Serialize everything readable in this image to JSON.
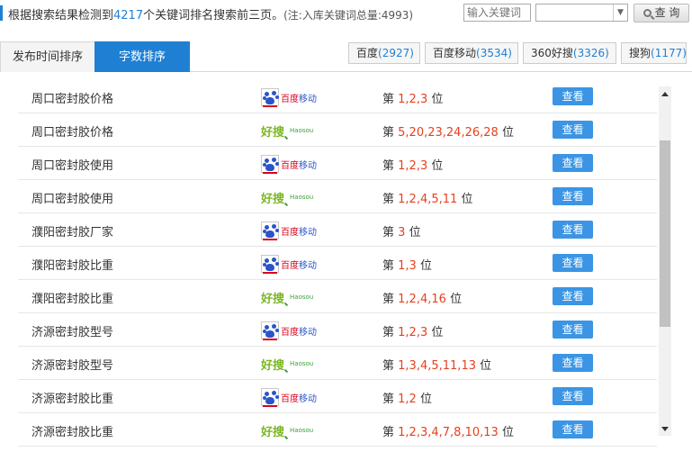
{
  "summary": {
    "prefix": "根据搜索结果检测到",
    "count": "4217",
    "suffix": "个关键词排名搜索前三页。",
    "note": "(注:入库关键词总量:4993)"
  },
  "search": {
    "placeholder": "输入关键词",
    "select_value": "",
    "query_label": "查 询"
  },
  "tabs": [
    {
      "label": "发布时间排序",
      "active": false
    },
    {
      "label": "字数排序",
      "active": true
    }
  ],
  "engines": [
    {
      "name": "百度",
      "count": "(2927)"
    },
    {
      "name": "百度移动",
      "count": "(3534)"
    },
    {
      "name": "360好搜",
      "count": "(3326)"
    },
    {
      "name": "搜狗",
      "count": "(1177)"
    }
  ],
  "logos": {
    "baidu_text_red": "百度",
    "baidu_text_blue": "移动",
    "hao_text_1": "好",
    "hao_text_2": "搜",
    "hao_text_en": "Haosou"
  },
  "rank_prefix": "第",
  "rank_suffix": "位",
  "view_label": "查看",
  "rows": [
    {
      "keyword": "周口密封胶价格",
      "engine": "baidu-mobile",
      "positions": "1,2,3"
    },
    {
      "keyword": "周口密封胶价格",
      "engine": "haosou",
      "positions": "5,20,23,24,26,28"
    },
    {
      "keyword": "周口密封胶使用",
      "engine": "baidu-mobile",
      "positions": "1,2,3"
    },
    {
      "keyword": "周口密封胶使用",
      "engine": "haosou",
      "positions": "1,2,4,5,11"
    },
    {
      "keyword": "濮阳密封胶厂家",
      "engine": "baidu-mobile",
      "positions": "3"
    },
    {
      "keyword": "濮阳密封胶比重",
      "engine": "baidu-mobile",
      "positions": "1,3"
    },
    {
      "keyword": "濮阳密封胶比重",
      "engine": "haosou",
      "positions": "1,2,4,16"
    },
    {
      "keyword": "济源密封胶型号",
      "engine": "baidu-mobile",
      "positions": "1,2,3"
    },
    {
      "keyword": "济源密封胶型号",
      "engine": "haosou",
      "positions": "1,3,4,5,11,13"
    },
    {
      "keyword": "济源密封胶比重",
      "engine": "baidu-mobile",
      "positions": "1,2"
    },
    {
      "keyword": "济源密封胶比重",
      "engine": "haosou",
      "positions": "1,2,3,4,7,8,10,13"
    }
  ],
  "colors": {
    "accent": "#1f80d3",
    "rank_red": "#e8401c",
    "button_blue": "#3b95e4"
  }
}
